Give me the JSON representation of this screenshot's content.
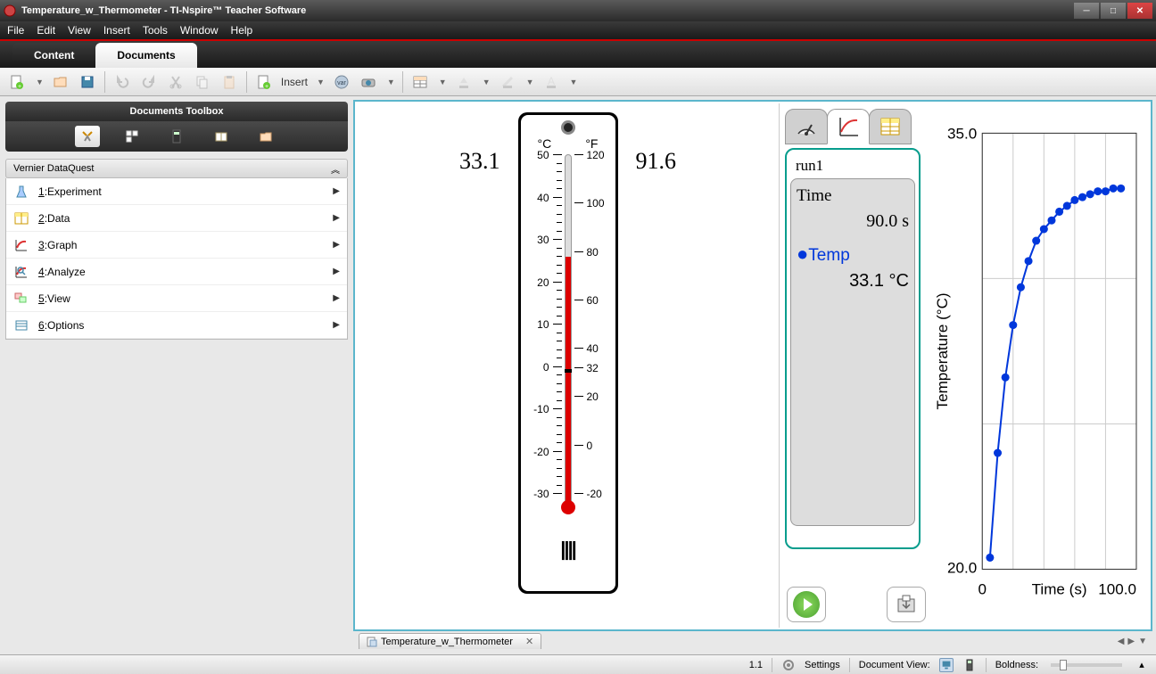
{
  "window": {
    "title": "Temperature_w_Thermometer - TI-Nspire™ Teacher Software"
  },
  "menubar": [
    "File",
    "Edit",
    "View",
    "Insert",
    "Tools",
    "Window",
    "Help"
  ],
  "tabs": {
    "content": "Content",
    "documents": "Documents"
  },
  "toolbar": {
    "insert_label": "Insert"
  },
  "toolbox": {
    "title": "Documents Toolbox"
  },
  "vendor_section": {
    "title": "Vernier DataQuest"
  },
  "vendor_menu": [
    {
      "idx": "1",
      "label": "Experiment"
    },
    {
      "idx": "2",
      "label": "Data"
    },
    {
      "idx": "3",
      "label": "Graph"
    },
    {
      "idx": "4",
      "label": "Analyze"
    },
    {
      "idx": "5",
      "label": "View"
    },
    {
      "idx": "6",
      "label": "Options"
    }
  ],
  "thermo": {
    "c_label": "°C",
    "f_label": "°F",
    "c_value": "33.1",
    "f_value": "91.6",
    "c_ticks": [
      "50",
      "40",
      "30",
      "20",
      "10",
      "0",
      "-10",
      "-20",
      "-30"
    ],
    "f_ticks": [
      "120",
      "100",
      "80",
      "60",
      "40",
      "32",
      "20",
      "0",
      "-20"
    ],
    "fill_pct": 71
  },
  "dataquest": {
    "run": "run1",
    "time_label": "Time",
    "time_value": "90.0 s",
    "temp_label": "Temp",
    "temp_value_num": "33.1",
    "temp_unit": " °C"
  },
  "chart_data": {
    "type": "scatter",
    "title": "",
    "xlabel": "Time (s)",
    "ylabel": "Temperature (°C)",
    "xlim": [
      0,
      100.0
    ],
    "ylim": [
      20.0,
      35.0
    ],
    "x_ticks": [
      "0",
      "100.0"
    ],
    "y_ticks": [
      "20.0",
      "35.0"
    ],
    "series": [
      {
        "name": "Temp",
        "color": "#0037db",
        "x": [
          5,
          10,
          15,
          20,
          25,
          30,
          35,
          40,
          45,
          50,
          55,
          60,
          65,
          70,
          75,
          80,
          85,
          90
        ],
        "y": [
          20.4,
          24.0,
          26.6,
          28.4,
          29.7,
          30.6,
          31.3,
          31.7,
          32.0,
          32.3,
          32.5,
          32.7,
          32.8,
          32.9,
          33.0,
          33.0,
          33.1,
          33.1
        ]
      }
    ]
  },
  "doctabs": {
    "name": "Temperature_w_Thermometer"
  },
  "statusbar": {
    "page": "1.1",
    "settings": "Settings",
    "docview": "Document View:",
    "boldness": "Boldness:"
  }
}
